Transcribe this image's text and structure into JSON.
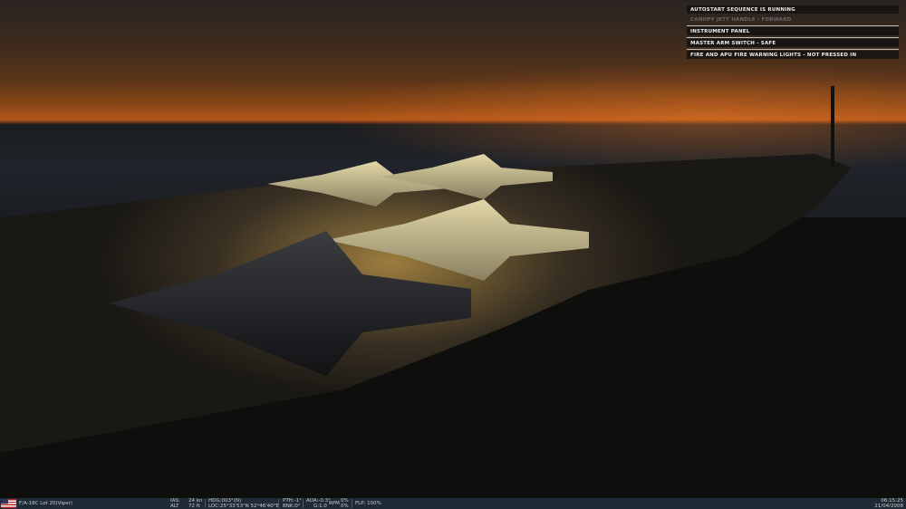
{
  "messages": [
    {
      "text": "AUTOSTART SEQUENCE IS RUNNING",
      "state": "active"
    },
    {
      "text": "CANOPY JETT HANDLE - FORWARD",
      "state": "done"
    },
    {
      "text": "INSTRUMENT PANEL",
      "state": "active"
    },
    {
      "text": "MASTER ARM SWITCH - SAFE",
      "state": "active"
    },
    {
      "text": "FIRE AND APU FIRE WARNING LIGHTS - NOT PRESSED IN",
      "state": "active"
    }
  ],
  "status": {
    "aircraft": "F/A-18C Lot 20(Viper)",
    "ias_label": "IAS:",
    "ias": "24 kn",
    "alt_label": "ALT",
    "alt": "72 ft",
    "hdg": "HDG:003°(N)",
    "loc": "LOC:25°33'53\"N 52°46'40\"E",
    "pth": "PTH:-1°",
    "bnk": "BNK:0°",
    "aoa": "AOA:-0.3°",
    "g": "G:1.0",
    "rpm_label": "RPM",
    "rpm1": "0%",
    "rpm2": "0%",
    "flp": "FLP: 100%",
    "time": "06:15:25",
    "date": "21/04/2008"
  }
}
